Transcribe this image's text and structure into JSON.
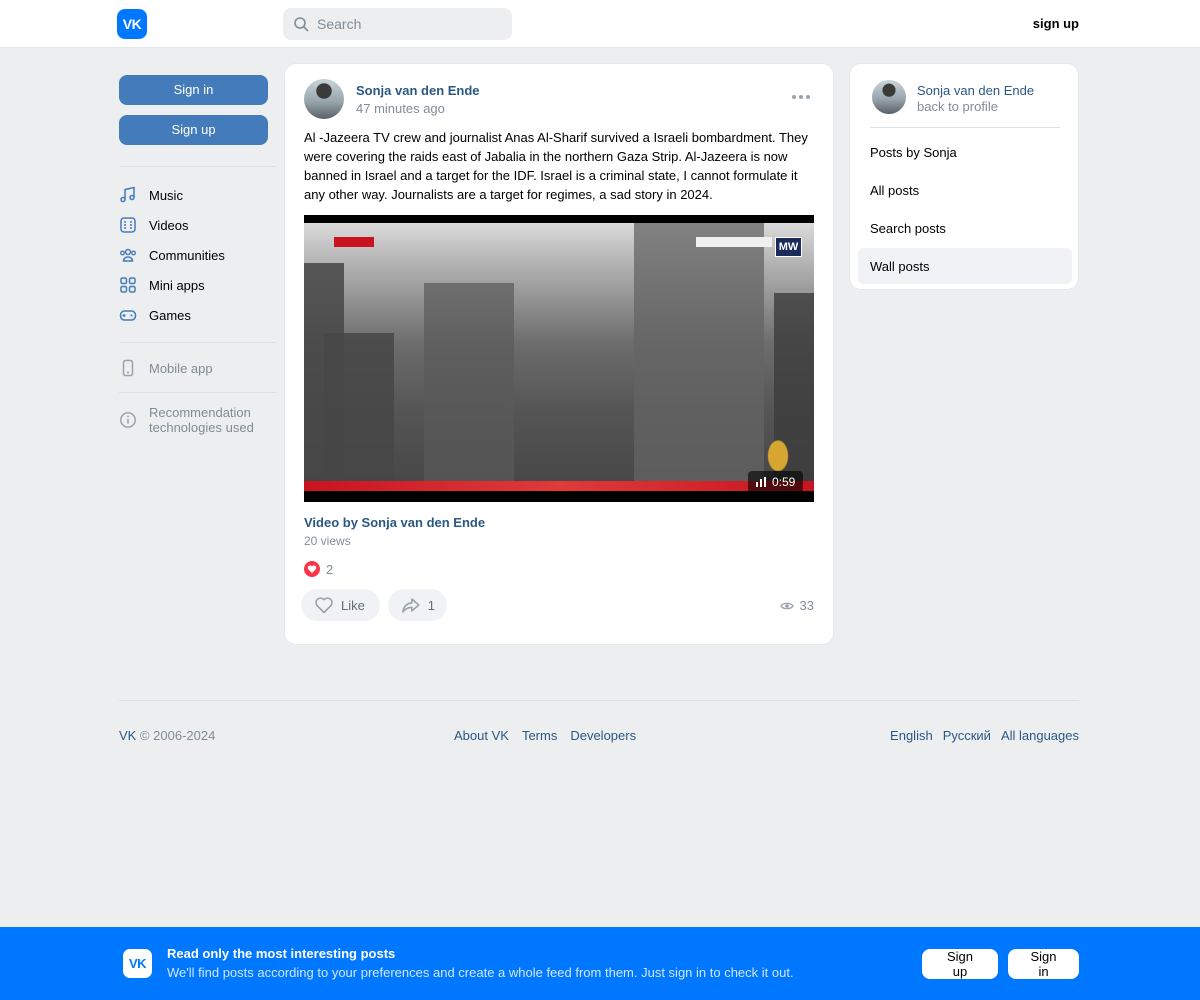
{
  "header": {
    "logo": "VK",
    "search_placeholder": "Search",
    "signup_label": "sign up"
  },
  "sidebar": {
    "signin_label": "Sign in",
    "signup_label": "Sign up",
    "items": [
      {
        "label": "Music",
        "icon": "music-icon"
      },
      {
        "label": "Videos",
        "icon": "videos-icon"
      },
      {
        "label": "Communities",
        "icon": "communities-icon"
      },
      {
        "label": "Mini apps",
        "icon": "mini-apps-icon"
      },
      {
        "label": "Games",
        "icon": "games-icon"
      }
    ],
    "mobile_app": "Mobile app",
    "recommendation": "Recommendation technologies used"
  },
  "post": {
    "author": "Sonja van den Ende",
    "time": "47 minutes ago",
    "text": "Al -Jazeera TV crew and journalist Anas Al-Sharif survived a Israeli bombardment. They were covering the raids east of Jabalia in the northern Gaza Strip. Al-Jazeera is now banned in Israel and a target for the IDF. Israel is a criminal state, I cannot formulate it any other way. Journalists are a target for regimes, a sad story in 2024.",
    "video": {
      "overlay_logo": "MW",
      "duration": "0:59",
      "title": "Video by Sonja van den Ende",
      "views": "20 views"
    },
    "reactions_count": "2",
    "like_label": "Like",
    "share_count": "1",
    "views_count": "33"
  },
  "right_panel": {
    "name": "Sonja van den Ende",
    "back": "back to profile",
    "menu": [
      {
        "label": "Posts by Sonja",
        "active": false
      },
      {
        "label": "All posts",
        "active": false
      },
      {
        "label": "Search posts",
        "active": false
      },
      {
        "label": "Wall posts",
        "active": true
      }
    ]
  },
  "footer": {
    "vk": "VK",
    "copyright": " © 2006-2024",
    "links": [
      "About VK",
      "Terms",
      "Developers"
    ],
    "languages": [
      "English",
      "Русский",
      "All languages"
    ]
  },
  "banner": {
    "logo": "VK",
    "title": "Read only the most interesting posts",
    "subtitle": "We'll find posts according to your preferences and create a whole feed from them. Just sign in to check it out.",
    "signup_label": "Sign up",
    "signin_label": "Sign in"
  },
  "colors": {
    "accent": "#0077ff",
    "link": "#2a5885",
    "button": "#447bba",
    "background": "#edeef0"
  }
}
